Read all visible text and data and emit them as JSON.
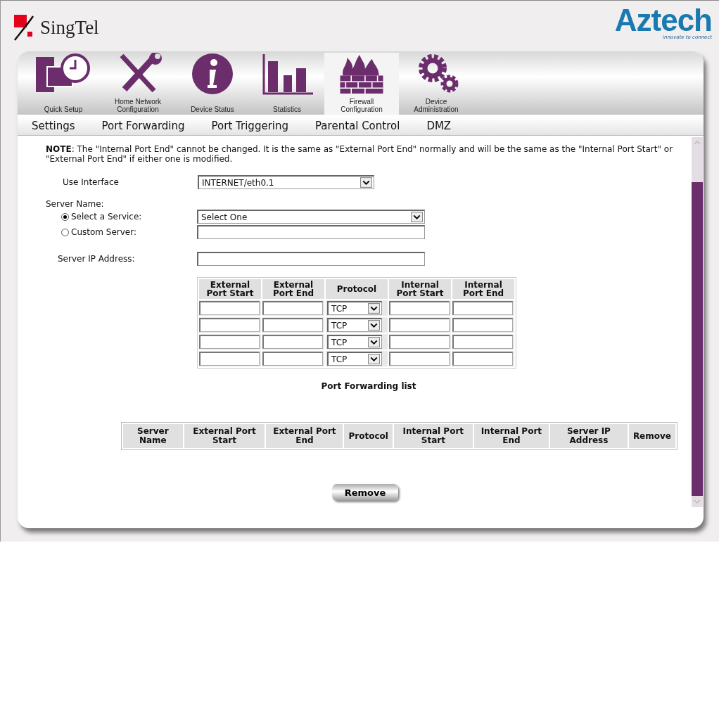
{
  "brand": {
    "operator": "SingTel",
    "vendor": "Aztech",
    "tagline": "innovate to connect"
  },
  "main_tabs": [
    {
      "label": "Quick Setup",
      "kind": "computer",
      "selected": false
    },
    {
      "label": "Home Network Configuration",
      "kind": "tools",
      "selected": false
    },
    {
      "label": "Device Status",
      "kind": "info",
      "selected": false
    },
    {
      "label": "Statistics",
      "kind": "bars",
      "selected": false
    },
    {
      "label": "Firewall Configuration",
      "kind": "firewall",
      "selected": true
    },
    {
      "label": "Device Administration",
      "kind": "gears",
      "selected": false
    }
  ],
  "sub_tabs": [
    "Settings",
    "Port Forwarding",
    "Port Triggering",
    "Parental Control",
    "DMZ"
  ],
  "note": "**NOTE**: The \"Internal Port End\" cannot be changed. It is the same as \"External Port End\" normally and will be the same as the \"Internal Port Start\" or \"External Port End\" if either one is modified.",
  "form": {
    "interface": {
      "label": "Use Interface",
      "value": "INTERNET/eth0.1"
    },
    "server_name_label": "Server Name:",
    "service_options": [
      {
        "label": "Select a Service:",
        "kind": "select",
        "selected": true,
        "value": "Select One"
      },
      {
        "label": "Custom Server:",
        "kind": "text",
        "selected": false
      }
    ],
    "server_ip": {
      "label": "Server IP Address:"
    }
  },
  "entry_table": {
    "columns": [
      "External Port Start",
      "External Port End",
      "Protocol",
      "Internal Port Start",
      "Internal Port End"
    ],
    "rows": [
      {
        "protocol": "TCP"
      },
      {
        "protocol": "TCP"
      },
      {
        "protocol": "TCP"
      },
      {
        "protocol": "TCP"
      }
    ]
  },
  "list": {
    "title": "Port Forwarding list",
    "columns": [
      "Server Name",
      "External Port Start",
      "External Port End",
      "Protocol",
      "Internal Port Start",
      "Internal Port End",
      "Server IP Address",
      "Remove"
    ]
  },
  "remove_button": "Remove"
}
